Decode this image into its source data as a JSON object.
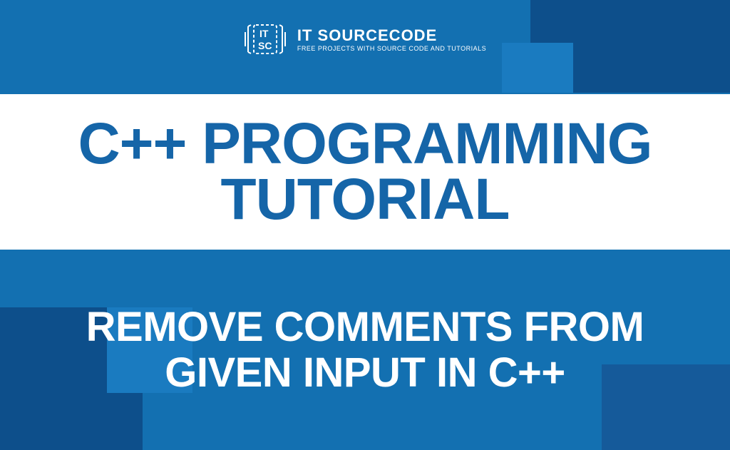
{
  "header": {
    "brand_name": "IT SOURCECODE",
    "tagline": "FREE PROJECTS WITH SOURCE CODE AND TUTORIALS"
  },
  "main": {
    "title": "C++ PROGRAMMING TUTORIAL",
    "subtitle": "REMOVE COMMENTS FROM GIVEN INPUT IN C++"
  },
  "colors": {
    "primary_blue": "#1370b1",
    "dark_blue": "#0d4f8b",
    "text_blue": "#1565a8",
    "white": "#ffffff"
  }
}
